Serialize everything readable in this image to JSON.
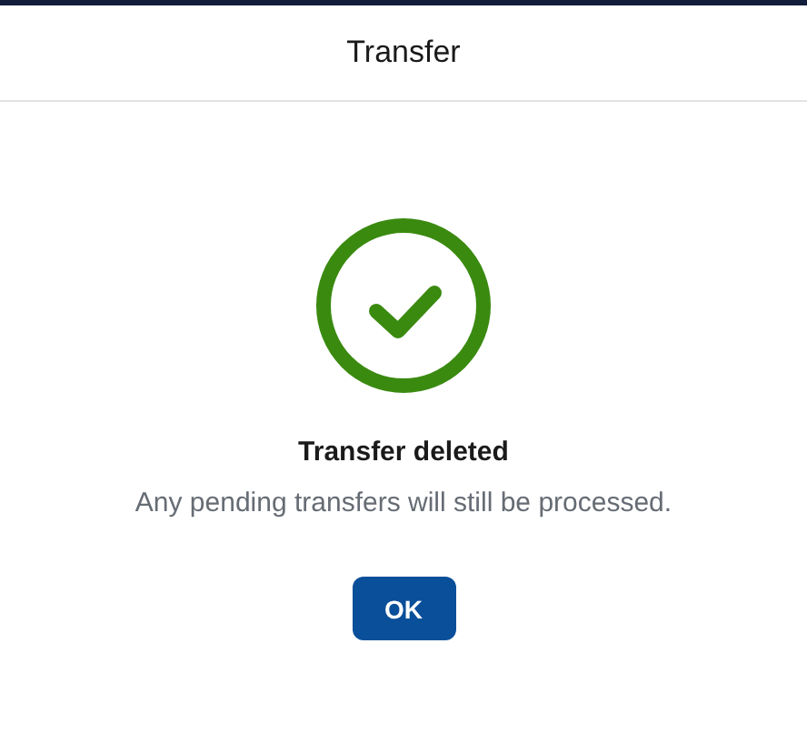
{
  "dialog": {
    "title": "Transfer",
    "result": {
      "kind": "success",
      "heading": "Transfer deleted",
      "message": "Any pending transfers will still be processed."
    },
    "buttons": [
      "OK"
    ]
  }
}
